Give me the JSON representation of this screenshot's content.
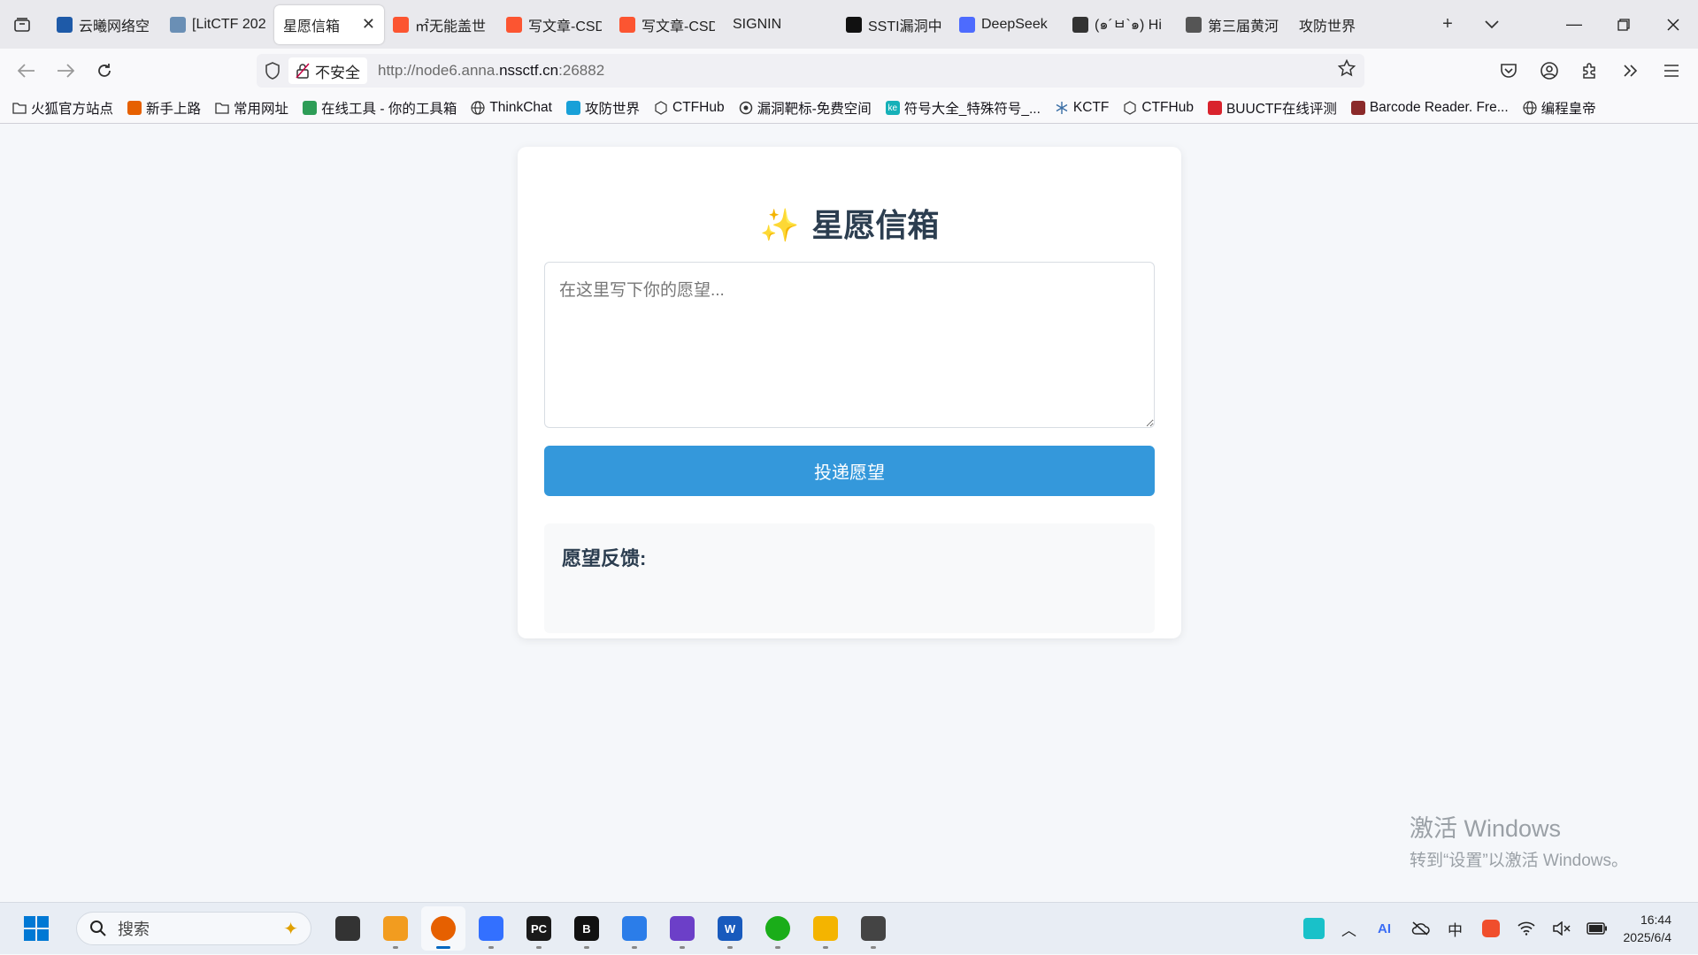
{
  "browser": {
    "tabs": [
      {
        "label": "云曦网络空",
        "icon_color": "#1e5aa8",
        "active": false
      },
      {
        "label": "[LitCTF 202",
        "icon_color": "#6a8fb5",
        "active": false
      },
      {
        "label": "星愿信箱",
        "icon_color": "",
        "active": true
      },
      {
        "label": "㎡无能盖世",
        "icon_color": "#fc5531",
        "active": false
      },
      {
        "label": "写文章-CSD",
        "icon_color": "#fc5531",
        "active": false
      },
      {
        "label": "写文章-CSD",
        "icon_color": "#fc5531",
        "active": false
      },
      {
        "label": "SIGNIN",
        "icon_color": "",
        "active": false
      },
      {
        "label": "SSTI漏洞中",
        "icon_color": "#111111",
        "active": false
      },
      {
        "label": "DeepSeek",
        "icon_color": "#4d6bfe",
        "active": false
      },
      {
        "label": "(๑´ㅂ`๑) Hi",
        "icon_color": "#333333",
        "active": false
      },
      {
        "label": "第三届黄河",
        "icon_color": "#555555",
        "active": false
      },
      {
        "label": "攻防世界",
        "icon_color": "",
        "active": false
      }
    ],
    "url": {
      "insecure_label": "不安全",
      "prefix": "http://node6.anna.",
      "host": "nssctf.cn",
      "suffix": ":26882"
    },
    "bookmarks": [
      {
        "label": "火狐官方站点",
        "icon": "folder-icon",
        "color": ""
      },
      {
        "label": "新手上路",
        "icon": "firefox-icon",
        "color": "#e66000"
      },
      {
        "label": "常用网址",
        "icon": "folder-icon",
        "color": ""
      },
      {
        "label": "在线工具 - 你的工具箱",
        "icon": "tool-icon",
        "color": "#2e9d57"
      },
      {
        "label": "ThinkChat",
        "icon": "globe-icon",
        "color": ""
      },
      {
        "label": "攻防世界",
        "icon": "adworld-icon",
        "color": "#18a0d8"
      },
      {
        "label": "CTFHub",
        "icon": "ctfhub-icon",
        "color": ""
      },
      {
        "label": "漏洞靶标-免费空间",
        "icon": "target-icon",
        "color": ""
      },
      {
        "label": "符号大全_特殊符号_...",
        "icon": "ke-icon",
        "color": "#16b0b8"
      },
      {
        "label": "KCTF",
        "icon": "snowflake-icon",
        "color": ""
      },
      {
        "label": "CTFHub",
        "icon": "ctfhub-icon",
        "color": ""
      },
      {
        "label": "BUUCTF在线评测",
        "icon": "buu-icon",
        "color": "#d9232d"
      },
      {
        "label": "Barcode Reader. Fre...",
        "icon": "barcode-icon",
        "color": "#8b2a2a"
      },
      {
        "label": "编程皇帝",
        "icon": "globe-icon",
        "color": ""
      }
    ]
  },
  "page": {
    "title_icon": "✨",
    "title": "星愿信箱",
    "wish_placeholder": "在这里写下你的愿望...",
    "submit_label": "投递愿望",
    "feedback_title": "愿望反馈:"
  },
  "watermark": {
    "line1": "激活 Windows",
    "line2": "转到“设置”以激活 Windows。"
  },
  "taskbar": {
    "search_placeholder": "搜索",
    "apps": [
      {
        "name": "taskview",
        "color": "#333333",
        "text": "",
        "active": false
      },
      {
        "name": "remote",
        "color": "#f29c1f",
        "text": "",
        "active": false
      },
      {
        "name": "firefox",
        "color": "#e66000",
        "text": "",
        "active": true
      },
      {
        "name": "feishu",
        "color": "#3370ff",
        "text": "",
        "active": false
      },
      {
        "name": "pycharm",
        "color": "#1a1a1a",
        "text": "PC",
        "active": false
      },
      {
        "name": "burp",
        "color": "#111111",
        "text": "B",
        "active": false
      },
      {
        "name": "notepad",
        "color": "#2b7de9",
        "text": "",
        "active": false
      },
      {
        "name": "vs",
        "color": "#6c3fc8",
        "text": "",
        "active": false
      },
      {
        "name": "word",
        "color": "#185abd",
        "text": "W",
        "active": false
      },
      {
        "name": "wechat",
        "color": "#1aad19",
        "text": "",
        "active": false
      },
      {
        "name": "explorer",
        "color": "#f4b400",
        "text": "",
        "active": false
      },
      {
        "name": "vpn",
        "color": "#444444",
        "text": "",
        "active": false
      }
    ],
    "time": "16:44",
    "date": "2025/6/4",
    "ime": "中"
  }
}
